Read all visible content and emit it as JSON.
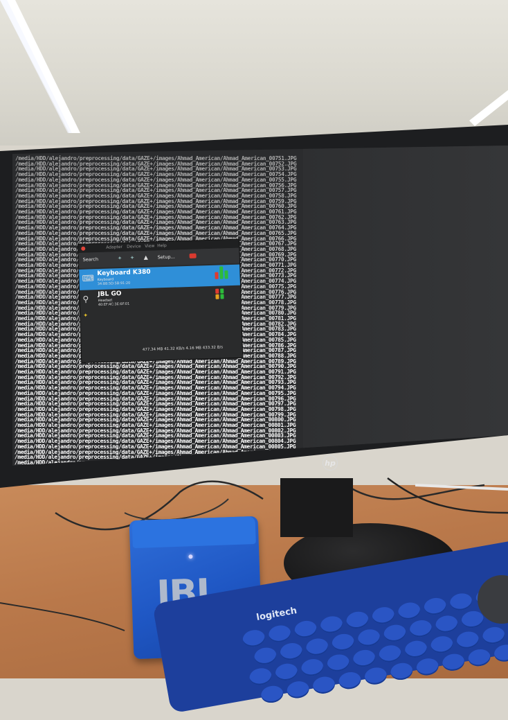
{
  "scene": {
    "description_colors": {
      "wall": "#dad8cf",
      "desk": "#b9784a",
      "monitor": "#1d1e20",
      "speaker": "#1f57c4",
      "keyboard": "#1d3f9c"
    }
  },
  "monitor": {
    "brand": "hp"
  },
  "terminal": {
    "path_prefix": "/media/HDD/alejandro/preprocessing/data/GAZE+/images/Ahmad_American/Ahmad_American_00",
    "first_frame": 751,
    "suffix": ".JPG"
  },
  "bluetooth_manager": {
    "menu": [
      "Adapter",
      "Device",
      "View",
      "Help"
    ],
    "toolbar": {
      "search_label": "Search",
      "setup_label": "Setup..."
    },
    "devices": [
      {
        "name": "Keyboard K380",
        "type": "Keyboard",
        "mac": "34:88:5D:5B:91:20",
        "selected": true
      },
      {
        "name": "JBL GO",
        "type": "Headset",
        "mac": "40:EF:4C:3E:6F:01",
        "selected": false
      }
    ],
    "status": "477.34 MB 41.32 KB/s   4.16 MB 433.32 B/s"
  },
  "speaker": {
    "logo": "JBL"
  },
  "keyboard": {
    "brand": "logitech"
  }
}
